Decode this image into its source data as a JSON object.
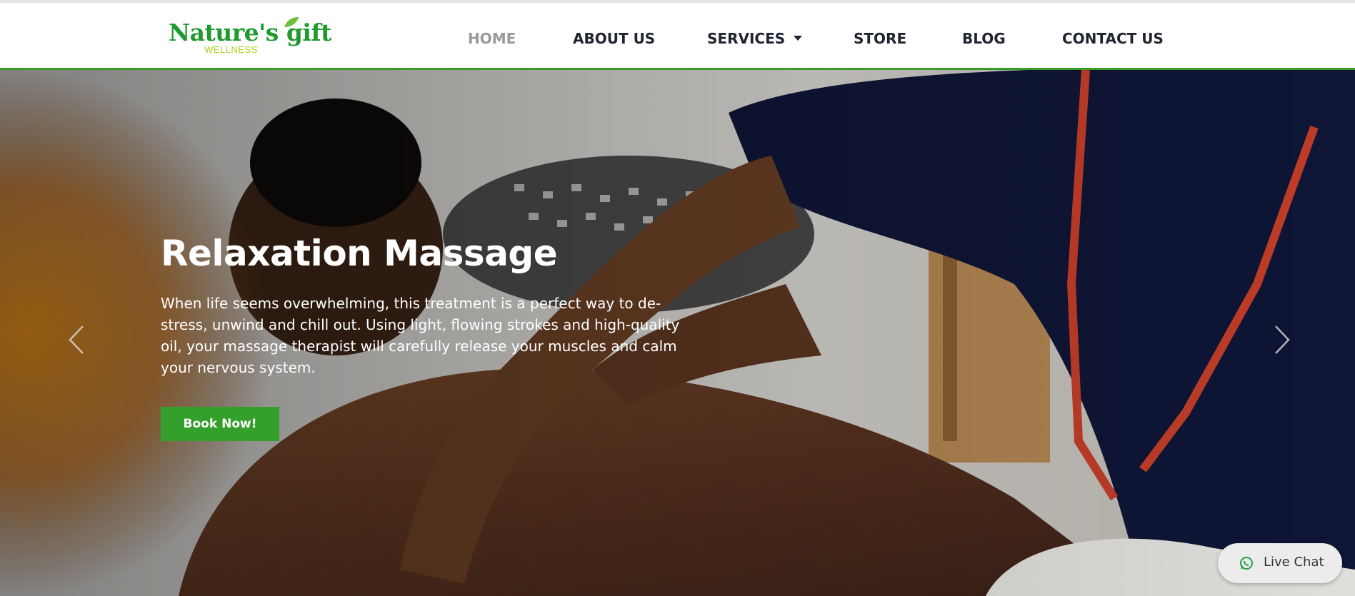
{
  "brand": {
    "name": "Nature's gift",
    "tagline": "WELLNESS",
    "primary_color": "#1f9a2e",
    "accent_color": "#a6d61c"
  },
  "nav": {
    "items": [
      {
        "label": "HOME",
        "active": true
      },
      {
        "label": "ABOUT US",
        "active": false
      },
      {
        "label": "SERVICES",
        "active": false,
        "has_dropdown": true
      },
      {
        "label": "STORE",
        "active": false
      },
      {
        "label": "BLOG",
        "active": false
      },
      {
        "label": "CONTACT US",
        "active": false
      }
    ]
  },
  "hero": {
    "title": "Relaxation Massage",
    "description": "When life seems overwhelming, this treatment is a perfect way to de-stress, unwind and chill out. Using light, flowing strokes and high-quality oil, your massage therapist will carefully release your muscles and calm your nervous system.",
    "cta_label": "Book Now!",
    "cta_color": "#33a02c",
    "prev_icon": "chevron-left-icon",
    "next_icon": "chevron-right-icon"
  },
  "chat": {
    "label": "Live Chat",
    "icon": "whatsapp-icon"
  }
}
